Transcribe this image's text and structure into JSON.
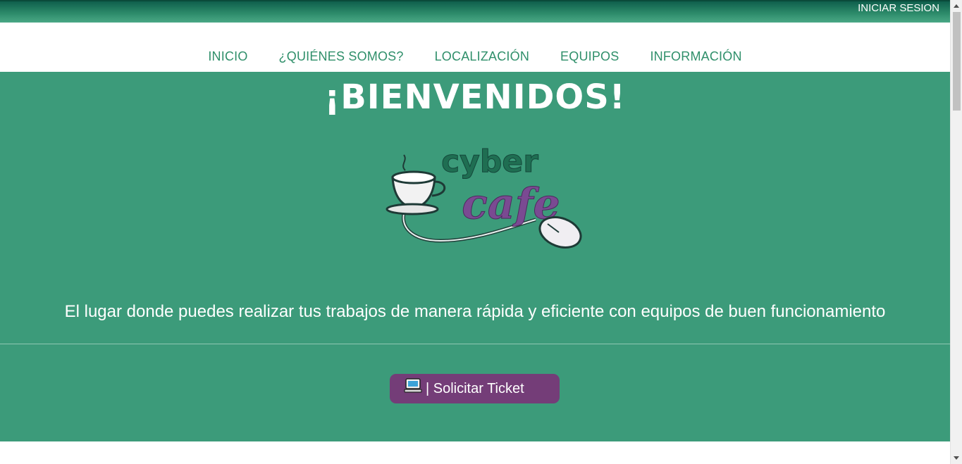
{
  "header": {
    "login_label": "INICIAR SESION"
  },
  "nav": {
    "items": [
      {
        "label": "INICIO"
      },
      {
        "label": "¿QUIÉNES SOMOS?"
      },
      {
        "label": "LOCALIZACIÓN"
      },
      {
        "label": "EQUIPOS"
      },
      {
        "label": "INFORMACIÓN"
      }
    ]
  },
  "hero": {
    "title": "¡BIENVENIDOS!",
    "logo_word_top": "cyber",
    "logo_word_bottom": "cafe",
    "tagline": "El lugar donde puedes realizar tus trabajos de manera rápida y eficiente con equipos de buen funcionamiento",
    "ticket_button_label": "| Solicitar Ticket",
    "ticket_icon": "computer-icon"
  },
  "colors": {
    "hero_bg": "#3c9b7a",
    "nav_text": "#2f8f6a",
    "button_bg": "#743d78"
  }
}
